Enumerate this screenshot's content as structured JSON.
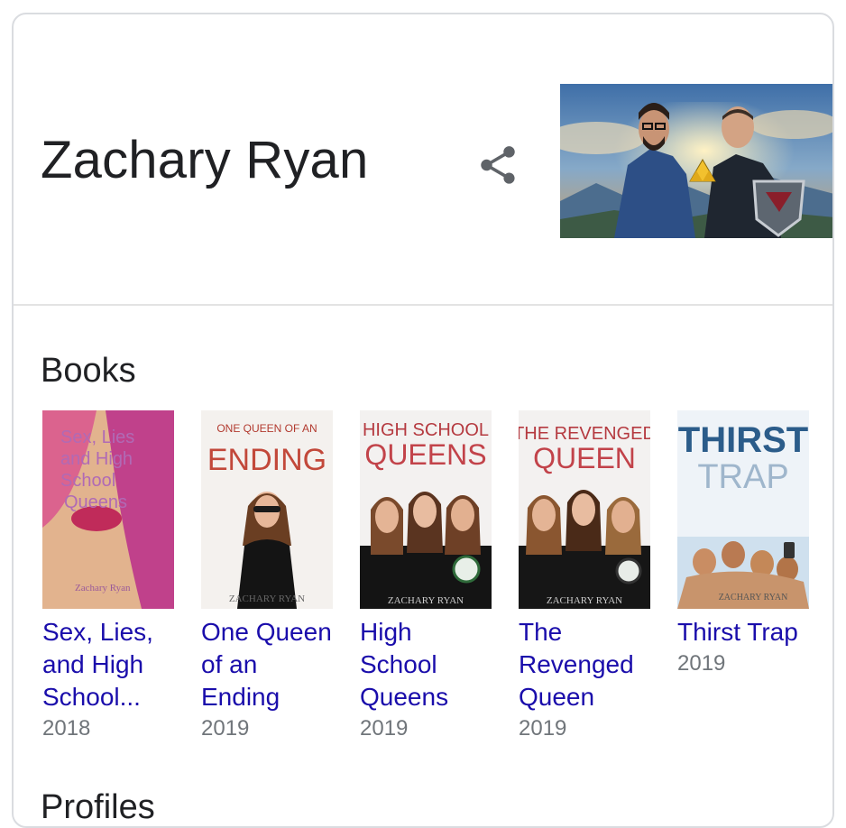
{
  "entity": {
    "name": "Zachary Ryan",
    "share_icon": "share-icon",
    "hero_image": "two-men-fantasy-background"
  },
  "books_section": {
    "title": "Books",
    "items": [
      {
        "title": "Sex, Lies, and High School...",
        "year": "2018",
        "cover_text": [
          "Sex, Lies",
          "and High",
          "School",
          "Queens"
        ],
        "cover_author": "Zachary Ryan"
      },
      {
        "title": "One Queen of an Ending",
        "year": "2019",
        "cover_text": [
          "ONE QUEEN OF AN",
          "ENDING"
        ],
        "cover_author": "ZACHARY RYAN"
      },
      {
        "title": "High School Queens",
        "year": "2019",
        "cover_text": [
          "HIGH SCHOOL",
          "QUEENS"
        ],
        "cover_author": "ZACHARY RYAN"
      },
      {
        "title": "The Revenged Queen",
        "year": "2019",
        "cover_text": [
          "THE REVENGED",
          "QUEEN"
        ],
        "cover_author": "ZACHARY RYAN"
      },
      {
        "title": "Thirst Trap",
        "year": "2019",
        "cover_text": [
          "THIRST",
          "TRAP"
        ],
        "cover_author": "ZACHARY RYAN"
      }
    ]
  },
  "next_section": {
    "title": "Profiles"
  },
  "colors": {
    "link": "#1a0dab",
    "meta": "#70757a",
    "text": "#202124",
    "border": "#dadce0"
  }
}
